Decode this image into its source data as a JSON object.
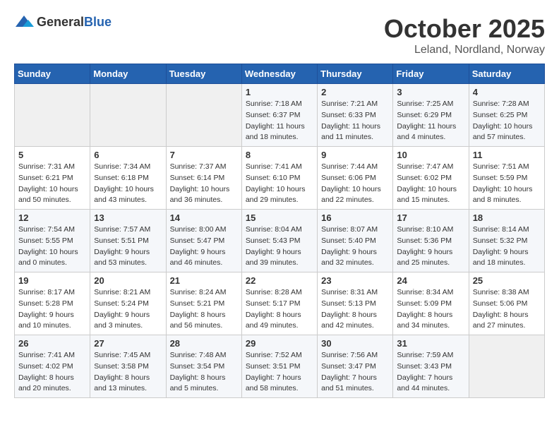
{
  "logo": {
    "general": "General",
    "blue": "Blue"
  },
  "header": {
    "month": "October 2025",
    "location": "Leland, Nordland, Norway"
  },
  "weekdays": [
    "Sunday",
    "Monday",
    "Tuesday",
    "Wednesday",
    "Thursday",
    "Friday",
    "Saturday"
  ],
  "weeks": [
    [
      {
        "day": "",
        "info": ""
      },
      {
        "day": "",
        "info": ""
      },
      {
        "day": "",
        "info": ""
      },
      {
        "day": "1",
        "info": "Sunrise: 7:18 AM\nSunset: 6:37 PM\nDaylight: 11 hours\nand 18 minutes."
      },
      {
        "day": "2",
        "info": "Sunrise: 7:21 AM\nSunset: 6:33 PM\nDaylight: 11 hours\nand 11 minutes."
      },
      {
        "day": "3",
        "info": "Sunrise: 7:25 AM\nSunset: 6:29 PM\nDaylight: 11 hours\nand 4 minutes."
      },
      {
        "day": "4",
        "info": "Sunrise: 7:28 AM\nSunset: 6:25 PM\nDaylight: 10 hours\nand 57 minutes."
      }
    ],
    [
      {
        "day": "5",
        "info": "Sunrise: 7:31 AM\nSunset: 6:21 PM\nDaylight: 10 hours\nand 50 minutes."
      },
      {
        "day": "6",
        "info": "Sunrise: 7:34 AM\nSunset: 6:18 PM\nDaylight: 10 hours\nand 43 minutes."
      },
      {
        "day": "7",
        "info": "Sunrise: 7:37 AM\nSunset: 6:14 PM\nDaylight: 10 hours\nand 36 minutes."
      },
      {
        "day": "8",
        "info": "Sunrise: 7:41 AM\nSunset: 6:10 PM\nDaylight: 10 hours\nand 29 minutes."
      },
      {
        "day": "9",
        "info": "Sunrise: 7:44 AM\nSunset: 6:06 PM\nDaylight: 10 hours\nand 22 minutes."
      },
      {
        "day": "10",
        "info": "Sunrise: 7:47 AM\nSunset: 6:02 PM\nDaylight: 10 hours\nand 15 minutes."
      },
      {
        "day": "11",
        "info": "Sunrise: 7:51 AM\nSunset: 5:59 PM\nDaylight: 10 hours\nand 8 minutes."
      }
    ],
    [
      {
        "day": "12",
        "info": "Sunrise: 7:54 AM\nSunset: 5:55 PM\nDaylight: 10 hours\nand 0 minutes."
      },
      {
        "day": "13",
        "info": "Sunrise: 7:57 AM\nSunset: 5:51 PM\nDaylight: 9 hours\nand 53 minutes."
      },
      {
        "day": "14",
        "info": "Sunrise: 8:00 AM\nSunset: 5:47 PM\nDaylight: 9 hours\nand 46 minutes."
      },
      {
        "day": "15",
        "info": "Sunrise: 8:04 AM\nSunset: 5:43 PM\nDaylight: 9 hours\nand 39 minutes."
      },
      {
        "day": "16",
        "info": "Sunrise: 8:07 AM\nSunset: 5:40 PM\nDaylight: 9 hours\nand 32 minutes."
      },
      {
        "day": "17",
        "info": "Sunrise: 8:10 AM\nSunset: 5:36 PM\nDaylight: 9 hours\nand 25 minutes."
      },
      {
        "day": "18",
        "info": "Sunrise: 8:14 AM\nSunset: 5:32 PM\nDaylight: 9 hours\nand 18 minutes."
      }
    ],
    [
      {
        "day": "19",
        "info": "Sunrise: 8:17 AM\nSunset: 5:28 PM\nDaylight: 9 hours\nand 10 minutes."
      },
      {
        "day": "20",
        "info": "Sunrise: 8:21 AM\nSunset: 5:24 PM\nDaylight: 9 hours\nand 3 minutes."
      },
      {
        "day": "21",
        "info": "Sunrise: 8:24 AM\nSunset: 5:21 PM\nDaylight: 8 hours\nand 56 minutes."
      },
      {
        "day": "22",
        "info": "Sunrise: 8:28 AM\nSunset: 5:17 PM\nDaylight: 8 hours\nand 49 minutes."
      },
      {
        "day": "23",
        "info": "Sunrise: 8:31 AM\nSunset: 5:13 PM\nDaylight: 8 hours\nand 42 minutes."
      },
      {
        "day": "24",
        "info": "Sunrise: 8:34 AM\nSunset: 5:09 PM\nDaylight: 8 hours\nand 34 minutes."
      },
      {
        "day": "25",
        "info": "Sunrise: 8:38 AM\nSunset: 5:06 PM\nDaylight: 8 hours\nand 27 minutes."
      }
    ],
    [
      {
        "day": "26",
        "info": "Sunrise: 7:41 AM\nSunset: 4:02 PM\nDaylight: 8 hours\nand 20 minutes."
      },
      {
        "day": "27",
        "info": "Sunrise: 7:45 AM\nSunset: 3:58 PM\nDaylight: 8 hours\nand 13 minutes."
      },
      {
        "day": "28",
        "info": "Sunrise: 7:48 AM\nSunset: 3:54 PM\nDaylight: 8 hours\nand 5 minutes."
      },
      {
        "day": "29",
        "info": "Sunrise: 7:52 AM\nSunset: 3:51 PM\nDaylight: 7 hours\nand 58 minutes."
      },
      {
        "day": "30",
        "info": "Sunrise: 7:56 AM\nSunset: 3:47 PM\nDaylight: 7 hours\nand 51 minutes."
      },
      {
        "day": "31",
        "info": "Sunrise: 7:59 AM\nSunset: 3:43 PM\nDaylight: 7 hours\nand 44 minutes."
      },
      {
        "day": "",
        "info": ""
      }
    ]
  ]
}
